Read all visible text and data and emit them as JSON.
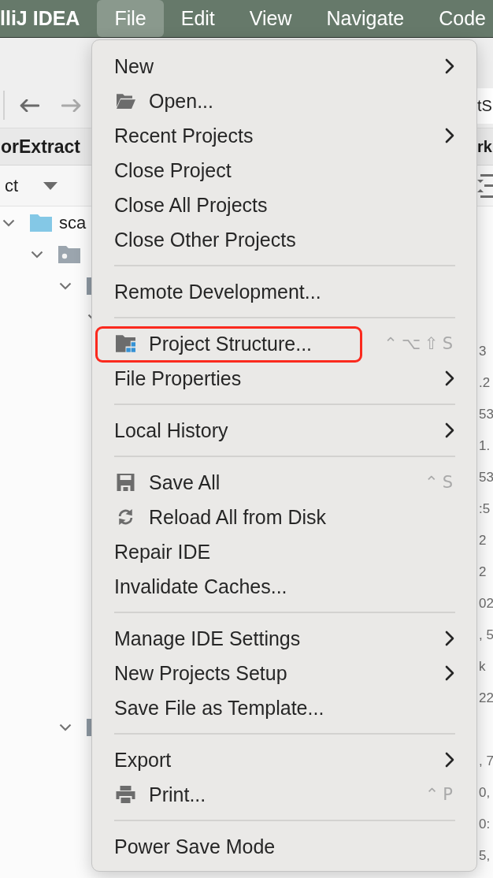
{
  "menu_bar": {
    "app_name": "lliJ IDEA",
    "items": [
      {
        "label": "File",
        "selected": true
      },
      {
        "label": "Edit",
        "selected": false
      },
      {
        "label": "View",
        "selected": false
      },
      {
        "label": "Navigate",
        "selected": false
      },
      {
        "label": "Code",
        "selected": false
      }
    ]
  },
  "toolbar": {
    "back": {
      "disabled": false
    },
    "forward": {
      "disabled": true
    }
  },
  "project_panel": {
    "title": "orExtract",
    "view_selector": "ct",
    "tree": [
      {
        "label": "sca",
        "expanded": true,
        "children": [
          {
            "expanded": true,
            "children": [
              {
                "expanded": true,
                "children": [
                  {
                    "expanded": true
                  }
                ]
              },
              {
                "expanded": true
              }
            ]
          }
        ]
      }
    ]
  },
  "editor": {
    "tab": "tS",
    "header": "rk",
    "line_groups": [
      [
        "3",
        ".2",
        "53",
        "1.",
        "53",
        ":5",
        "2",
        "2",
        "02",
        ", 5",
        "k",
        "22"
      ],
      [
        ", 7",
        "0,",
        "0:",
        "5,"
      ]
    ]
  },
  "file_menu": {
    "groups": [
      [
        {
          "label": "New",
          "submenu": true,
          "highlighted": false
        },
        {
          "label": "Open...",
          "submenu": false,
          "highlighted": false
        },
        {
          "label": "Recent Projects",
          "submenu": true,
          "highlighted": false
        },
        {
          "label": "Close Project",
          "submenu": false,
          "highlighted": false
        },
        {
          "label": "Close All Projects",
          "submenu": false,
          "highlighted": false
        },
        {
          "label": "Close Other Projects",
          "submenu": false,
          "highlighted": false
        }
      ],
      [
        {
          "label": "Remote Development...",
          "submenu": false,
          "highlighted": false
        }
      ],
      [
        {
          "label": "Project Structure...",
          "submenu": false,
          "highlighted": true,
          "shortcut": "⌃⌥⇧S"
        },
        {
          "label": "File Properties",
          "submenu": true,
          "highlighted": false
        }
      ],
      [
        {
          "label": "Local History",
          "submenu": true,
          "highlighted": false
        }
      ],
      [
        {
          "label": "Save All",
          "submenu": false,
          "highlighted": false,
          "shortcut": "⌃S"
        },
        {
          "label": "Reload All from Disk",
          "submenu": false,
          "highlighted": false
        },
        {
          "label": "Repair IDE",
          "submenu": false,
          "highlighted": false
        },
        {
          "label": "Invalidate Caches...",
          "submenu": false,
          "highlighted": false
        }
      ],
      [
        {
          "label": "Manage IDE Settings",
          "submenu": true,
          "highlighted": false
        },
        {
          "label": "New Projects Setup",
          "submenu": true,
          "highlighted": false
        },
        {
          "label": "Save File as Template...",
          "submenu": false,
          "highlighted": false
        }
      ],
      [
        {
          "label": "Export",
          "submenu": true,
          "highlighted": false
        },
        {
          "label": "Print...",
          "submenu": false,
          "highlighted": false,
          "shortcut": "⌃P"
        }
      ],
      [
        {
          "label": "Power Save Mode",
          "submenu": false,
          "highlighted": false
        }
      ]
    ]
  }
}
